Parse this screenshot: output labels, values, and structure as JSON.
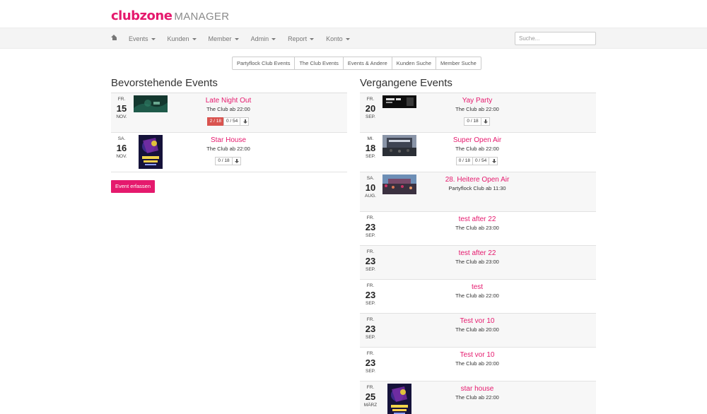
{
  "brand": {
    "part1": "clubzone",
    "part2": "MANAGER"
  },
  "nav": {
    "items": [
      "Events",
      "Kunden",
      "Member",
      "Admin",
      "Report",
      "Konto"
    ],
    "search_placeholder": "Suche..."
  },
  "filters": [
    "Partyflock Club Events",
    "The Club Events",
    "Events & Andere",
    "Kunden Suche",
    "Member Suche"
  ],
  "upcoming": {
    "title": "Bevorstehende Events",
    "create_label": "Event erfassen",
    "events": [
      {
        "dow": "FR.",
        "day": "15",
        "mon": "NOV.",
        "title": "Late Night Out",
        "venue": "The Club ab 22:00",
        "stats": [
          "2 / 18",
          "0 / 54"
        ],
        "highlight": true,
        "thumb": "green"
      },
      {
        "dow": "SA.",
        "day": "16",
        "mon": "NOV.",
        "title": "Star House",
        "venue": "The Club ab 22:00",
        "stats": [
          "0 / 18"
        ],
        "highlight": false,
        "thumb": "poster"
      }
    ]
  },
  "past": {
    "title": "Vergangene Events",
    "events": [
      {
        "dow": "FR.",
        "day": "20",
        "mon": "SEP.",
        "title": "Yay Party",
        "venue": "The Club ab 22:00",
        "stats": [
          "0 / 18"
        ],
        "thumb": "dark"
      },
      {
        "dow": "MI.",
        "day": "18",
        "mon": "SEP.",
        "title": "Super Open Air",
        "venue": "The Club ab 22:00",
        "stats": [
          "0 / 18",
          "0 / 54"
        ],
        "thumb": "stage"
      },
      {
        "dow": "SA.",
        "day": "10",
        "mon": "AUG.",
        "title": "28. Heitere Open Air",
        "venue": "Partyflock Club ab 11:30",
        "stats": [],
        "thumb": "crowd"
      },
      {
        "dow": "FR.",
        "day": "23",
        "mon": "SEP.",
        "title": "test after 22",
        "venue": "The Club ab 23:00",
        "stats": [],
        "thumb": ""
      },
      {
        "dow": "FR.",
        "day": "23",
        "mon": "SEP.",
        "title": "test after 22",
        "venue": "The Club ab 23:00",
        "stats": [],
        "thumb": ""
      },
      {
        "dow": "FR.",
        "day": "23",
        "mon": "SEP.",
        "title": "test",
        "venue": "The Club ab 22:00",
        "stats": [],
        "thumb": ""
      },
      {
        "dow": "FR.",
        "day": "23",
        "mon": "SEP.",
        "title": "Test vor 10",
        "venue": "The Club ab 20:00",
        "stats": [],
        "thumb": ""
      },
      {
        "dow": "FR.",
        "day": "23",
        "mon": "SEP.",
        "title": "Test vor 10",
        "venue": "The Club ab 20:00",
        "stats": [],
        "thumb": ""
      },
      {
        "dow": "FR.",
        "day": "25",
        "mon": "MÄRZ",
        "title": "star house",
        "venue": "The Club ab 22:00",
        "stats": [],
        "thumb": "poster"
      }
    ]
  }
}
